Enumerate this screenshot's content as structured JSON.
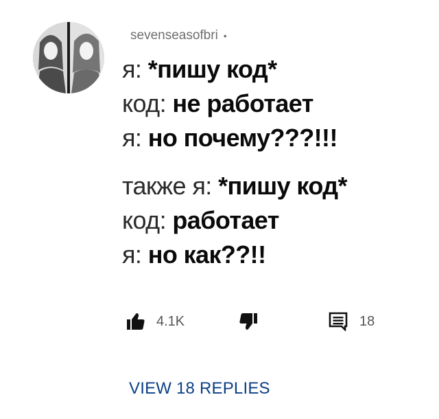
{
  "comment": {
    "author": "sevenseasofbri",
    "author_separator": "•",
    "lines": [
      {
        "lead": "я:",
        "rest": "*пишу код*"
      },
      {
        "lead": "код:",
        "rest": "не работает"
      },
      {
        "lead": "я:",
        "rest": "но почему???!!!"
      },
      {
        "lead": "также я:",
        "rest": "*пишу код*"
      },
      {
        "lead": "код:",
        "rest": "работает"
      },
      {
        "lead": "я:",
        "rest": "но как??!!"
      }
    ],
    "like_count": "4.1K",
    "reply_count": "18",
    "view_replies_label": "VIEW 18 REPLIES"
  },
  "icons": {
    "like": "thumbs-up-icon",
    "dislike": "thumbs-down-icon",
    "reply": "comment-icon",
    "avatar": "avatar-image"
  },
  "colors": {
    "text": "#0f0f0f",
    "muted": "#6e6e6e",
    "link": "#0b3f86",
    "icon": "#111111"
  }
}
